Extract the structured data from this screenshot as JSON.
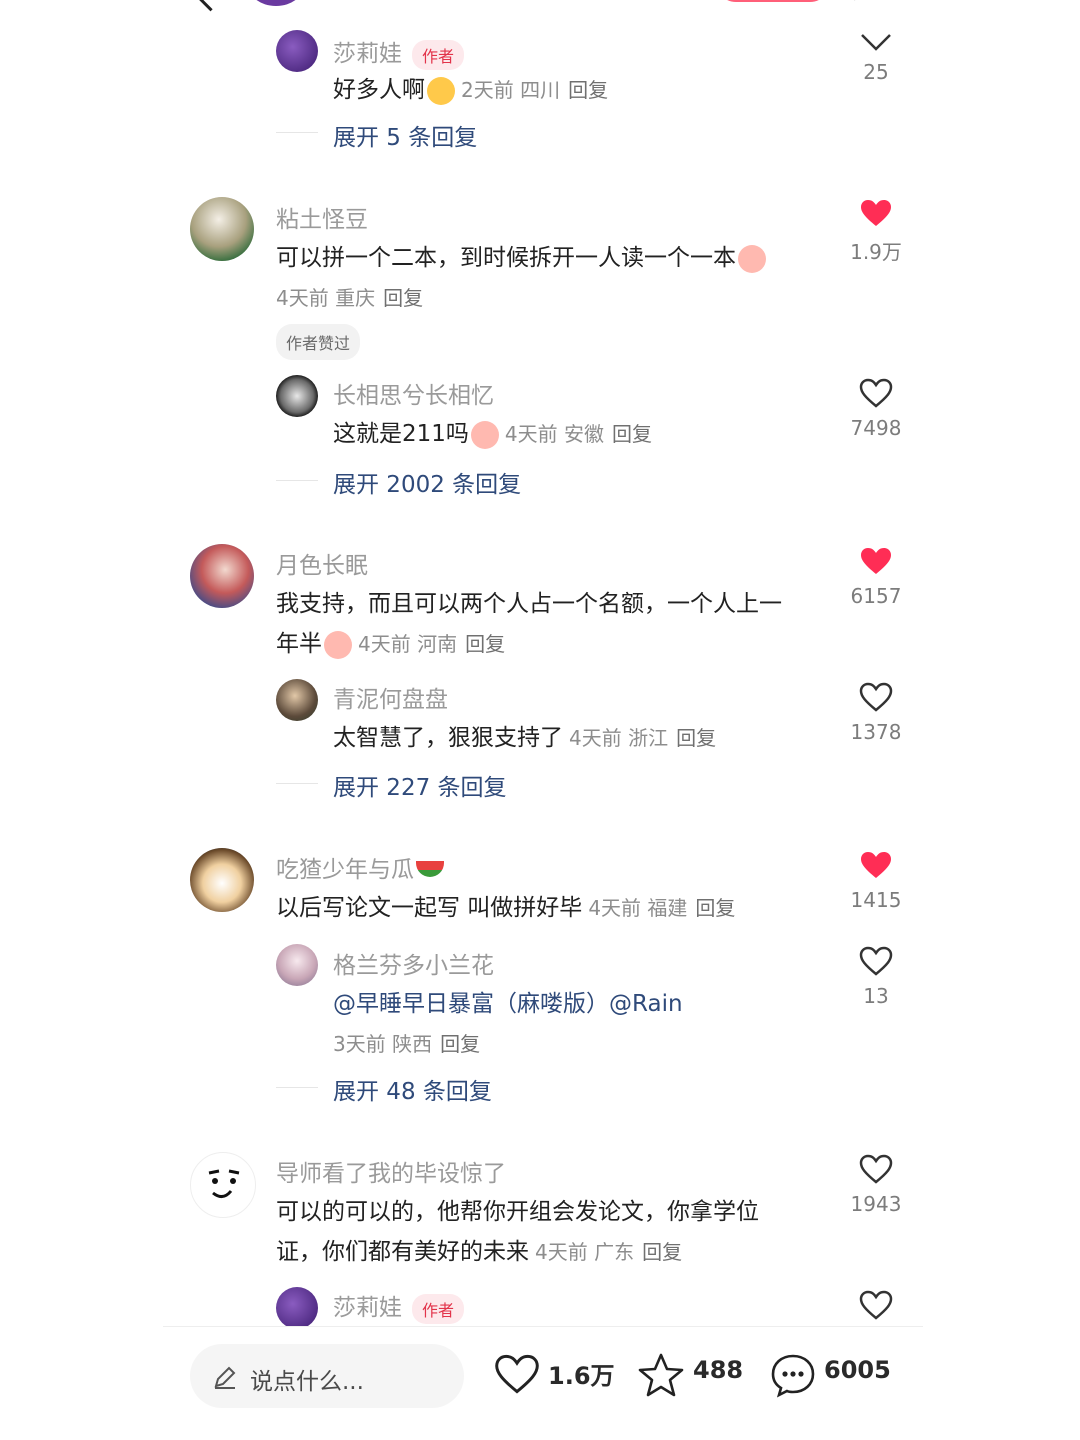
{
  "top": {
    "first_reply_name": "莎莉娃",
    "author_tag": "作者",
    "first_reply_text": "好多人啊",
    "first_reply_meta": "2天前 四川",
    "first_reply_likes": "25",
    "expand_1": "展开 5 条回复",
    "reply_label": "回复"
  },
  "comments": [
    {
      "name": "粘土怪豆",
      "text": "可以拼一个二本，到时候拆开一人读一个一本",
      "meta": "4天前 重庆",
      "likes": "1.9万",
      "badge": "作者赞过",
      "reply": {
        "name": "长相思兮长相忆",
        "text": "这就是211吗",
        "meta": "4天前 安徽",
        "likes": "7498"
      },
      "expand": "展开 2002 条回复"
    },
    {
      "name": "月色长眠",
      "text_line1": "我支持，而且可以两个人占一个名额，一个人上一",
      "text_line2": "年半",
      "meta": "4天前 河南",
      "likes": "6157",
      "reply": {
        "name": "青泥何盘盘",
        "text": "太智慧了，狠狠支持了",
        "meta": "4天前 浙江",
        "likes": "1378"
      },
      "expand": "展开 227 条回复"
    },
    {
      "name": "吃猹少年与瓜",
      "text": "以后写论文一起写 叫做拼好毕",
      "meta": "4天前 福建",
      "likes": "1415",
      "reply": {
        "name": "格兰芬多小兰花",
        "text": "@早睡早日暴富（麻喽版）@Rain",
        "meta": "3天前 陕西",
        "likes": "13"
      },
      "expand": "展开 48 条回复"
    },
    {
      "name": "导师看了我的毕设惊了",
      "text_line1": "可以的可以的，他帮你开组会发论文，你拿学位",
      "text_line2": "证，你们都有美好的未来",
      "meta": "4天前 广东",
      "likes": "1943",
      "reply": {
        "name": "莎莉娃"
      }
    }
  ],
  "bottom": {
    "input_placeholder": "说点什么...",
    "likes": "1.6万",
    "stars": "488",
    "comments": "6005"
  },
  "colors": {
    "like_red": "#ff2d55",
    "link_blue": "#2f4a7a",
    "author_tag": "#e2334a"
  }
}
